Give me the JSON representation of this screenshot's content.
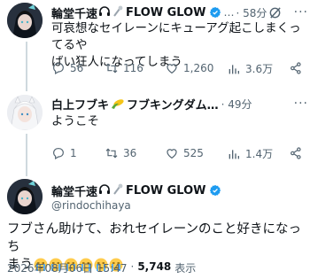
{
  "tweet1": {
    "name": "輪堂千速",
    "name_suffix": "FLOW GLOW",
    "ellipsis": "…",
    "time": "· 58分",
    "text_line1": "可哀想なセイレーンにキューアグ起こしまくってるや",
    "text_line2": "ばい狂人になってしまう",
    "replies": "56",
    "retweets": "116",
    "likes": "1,260",
    "views": "3.6万"
  },
  "tweet2": {
    "name": "白上フブキ",
    "name_suffix": "フブキングダム…",
    "time": "· 49分",
    "text": "ようこそ",
    "replies": "1",
    "retweets": "36",
    "likes": "525",
    "views": "1.4万"
  },
  "tweet3": {
    "name": "輪堂千速",
    "name_suffix": "FLOW GLOW",
    "handle": "@rindochihaya",
    "text_line1": "フブさん助けて、おれセイレーンのこと好きになっち",
    "text_line2": "まう",
    "timestamp": "2026年08月06日 15:47",
    "dot": "·",
    "views_count": "5,748",
    "views_label": "表示"
  },
  "colors": {
    "verified": "#1d9bf0",
    "text": "#0f1419",
    "muted": "#536471",
    "thread_line": "#cfd9de"
  }
}
